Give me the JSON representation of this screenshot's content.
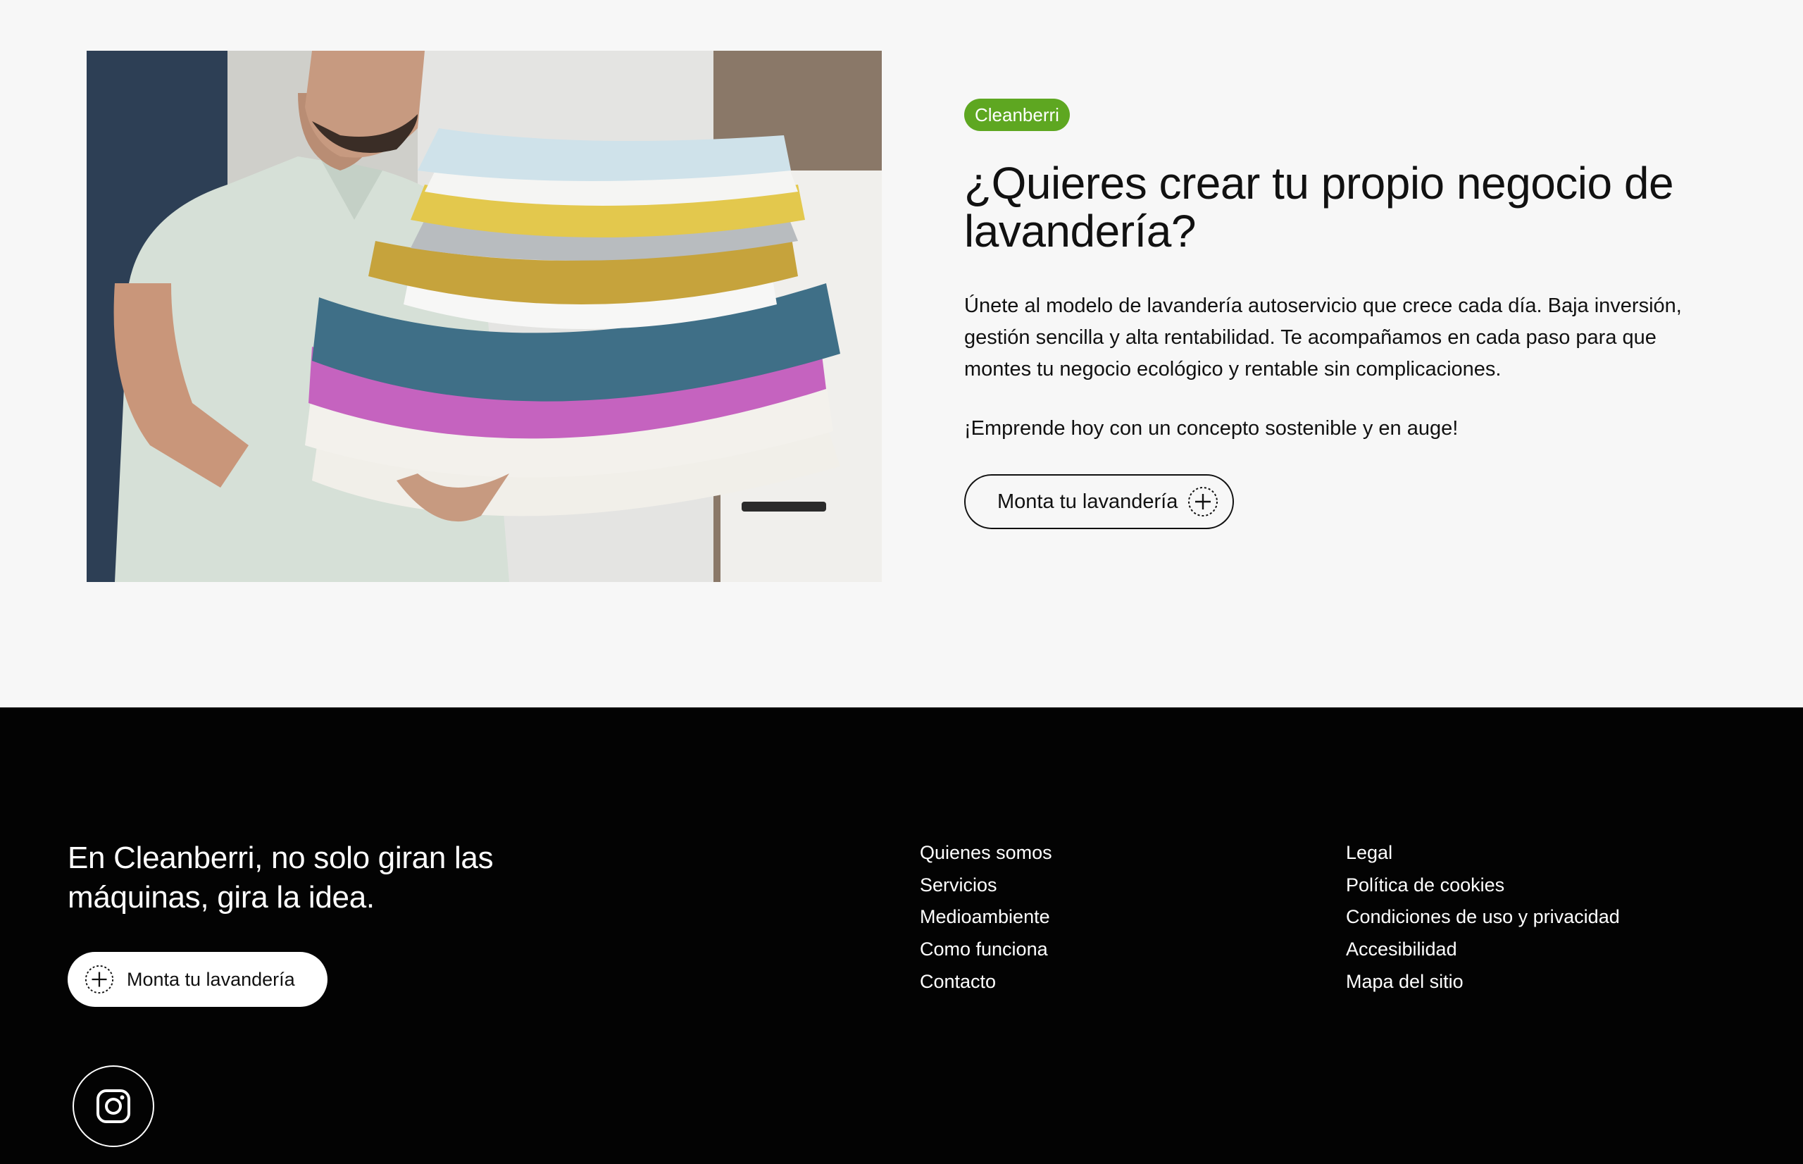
{
  "hero": {
    "tag": "Cleanberri",
    "title": "¿Quieres crear tu propio negocio de lavandería?",
    "description": "Únete al modelo de lavandería autoservicio que crece cada día. Baja inversión, gestión sencilla y alta rentabilidad. Te acompañamos en cada paso para que montes tu negocio ecológico y rentable sin complicaciones.",
    "cta_text": "¡Emprende hoy con un concepto sostenible y en auge!",
    "button_label": "Monta tu lavandería",
    "button_icon": "plus-circle-icon",
    "tag_color": "#5ea721"
  },
  "footer": {
    "tagline": "En Cleanberri, no solo giran las máquinas, gira la idea.",
    "button_label": "Monta tu lavandería",
    "button_icon": "plus-circle-icon",
    "social_icon": "instagram-icon",
    "links_col1": [
      "Quienes somos",
      "Servicios",
      "Medioambiente",
      "Como funciona",
      "Contacto"
    ],
    "links_col2": [
      "Legal",
      "Política de cookies",
      "Condiciones de uso y privacidad",
      "Accesibilidad",
      "Mapa del sitio"
    ],
    "background": "#030303"
  }
}
